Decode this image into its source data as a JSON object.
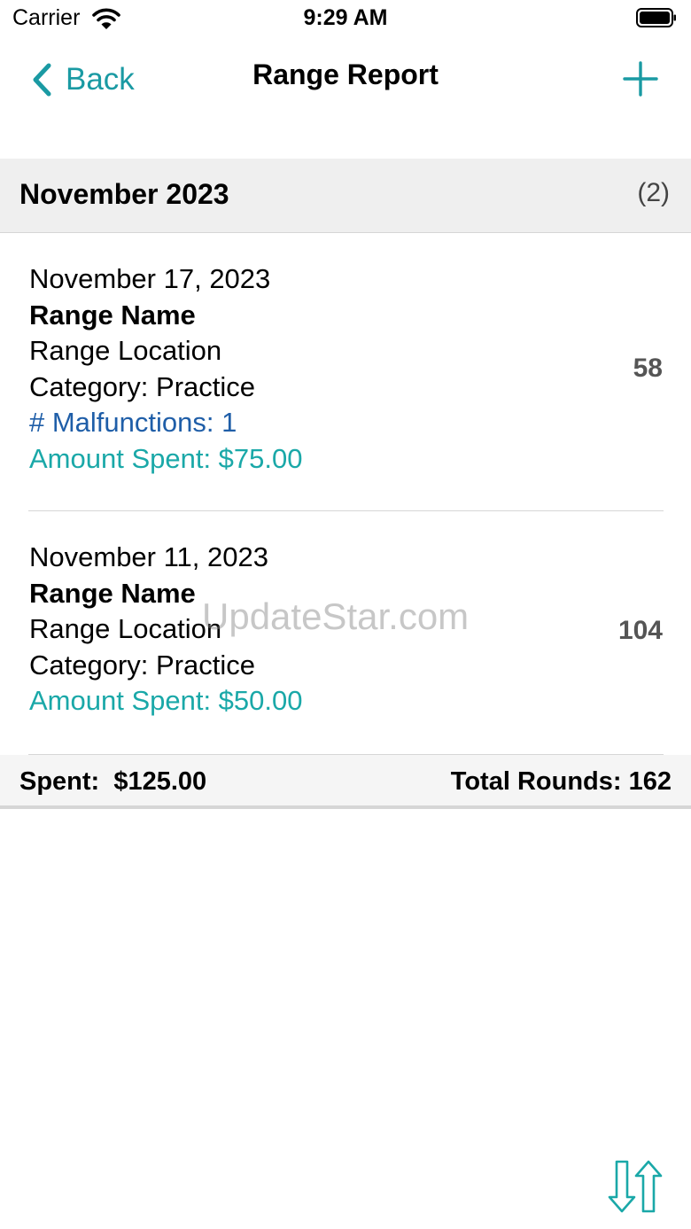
{
  "status_bar": {
    "carrier": "Carrier",
    "time": "9:29 AM"
  },
  "nav": {
    "back_label": "Back",
    "title": "Range Report"
  },
  "section": {
    "title": "November 2023",
    "count": "(2)"
  },
  "entries": [
    {
      "date": "November 17, 2023",
      "name": "Range Name",
      "location": "Range Location",
      "category": "Category: Practice",
      "malfunctions": "# Malfunctions: 1",
      "amount": "Amount Spent: $75.00",
      "rounds": "58"
    },
    {
      "date": "November 11, 2023",
      "name": "Range Name",
      "location": "Range Location",
      "category": "Category: Practice",
      "amount": "Amount Spent: $50.00",
      "rounds": "104"
    }
  ],
  "totals": {
    "spent": "Spent:  $125.00",
    "rounds": "Total Rounds: 162"
  },
  "watermark": "UpdateStar.com",
  "colors": {
    "accent": "#1a9aa3",
    "malfunction": "#1f5ea8",
    "amount": "#1aa8a8"
  },
  "icons": {
    "back": "chevron-left-icon",
    "add": "plus-icon",
    "sort": "sort-arrows-icon"
  }
}
